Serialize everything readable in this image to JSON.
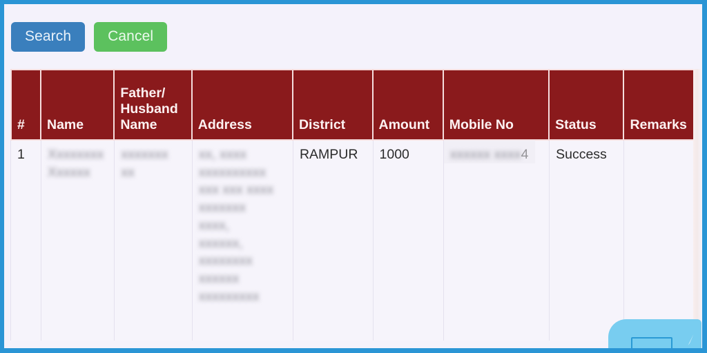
{
  "theme": {
    "frame_border_color": "#2a95d5",
    "page_background": "#f4f2fb",
    "table_header_background": "#8a1a1c",
    "table_header_text": "#fdf2f2",
    "search_button_color": "#3a7fbd",
    "cancel_button_color": "#5cc15e",
    "chat_widget_color": "#78cdf0"
  },
  "toolbar": {
    "search_label": "Search",
    "cancel_label": "Cancel"
  },
  "table": {
    "columns": [
      {
        "key": "index",
        "label": "#"
      },
      {
        "key": "name",
        "label": "Name"
      },
      {
        "key": "father",
        "label": "Father/\nHusband\nName"
      },
      {
        "key": "address",
        "label": "Address"
      },
      {
        "key": "district",
        "label": "District"
      },
      {
        "key": "amount",
        "label": "Amount"
      },
      {
        "key": "mobile",
        "label": "Mobile No"
      },
      {
        "key": "status",
        "label": "Status"
      },
      {
        "key": "remarks",
        "label": "Remarks"
      }
    ],
    "rows": [
      {
        "index": "1",
        "name_redacted": "Xxxxxxxx\nXxxxxx",
        "father_redacted": "xxxxxxx\nxx",
        "address_redacted": "xx, xxxx\nxxxxxxxxxx\nxxx xxx xxxx\nxxxxxxx\nxxxx,\nxxxxxx,\nxxxxxxxx\nxxxxxx\nxxxxxxxxx",
        "district": "RAMPUR",
        "amount": "1000",
        "mobile_redacted": "xxxxxx xxxx",
        "mobile_visible_suffix": "4",
        "status": "Success",
        "remarks": ""
      }
    ]
  },
  "chat_widget": {
    "icon": "send-icon"
  }
}
